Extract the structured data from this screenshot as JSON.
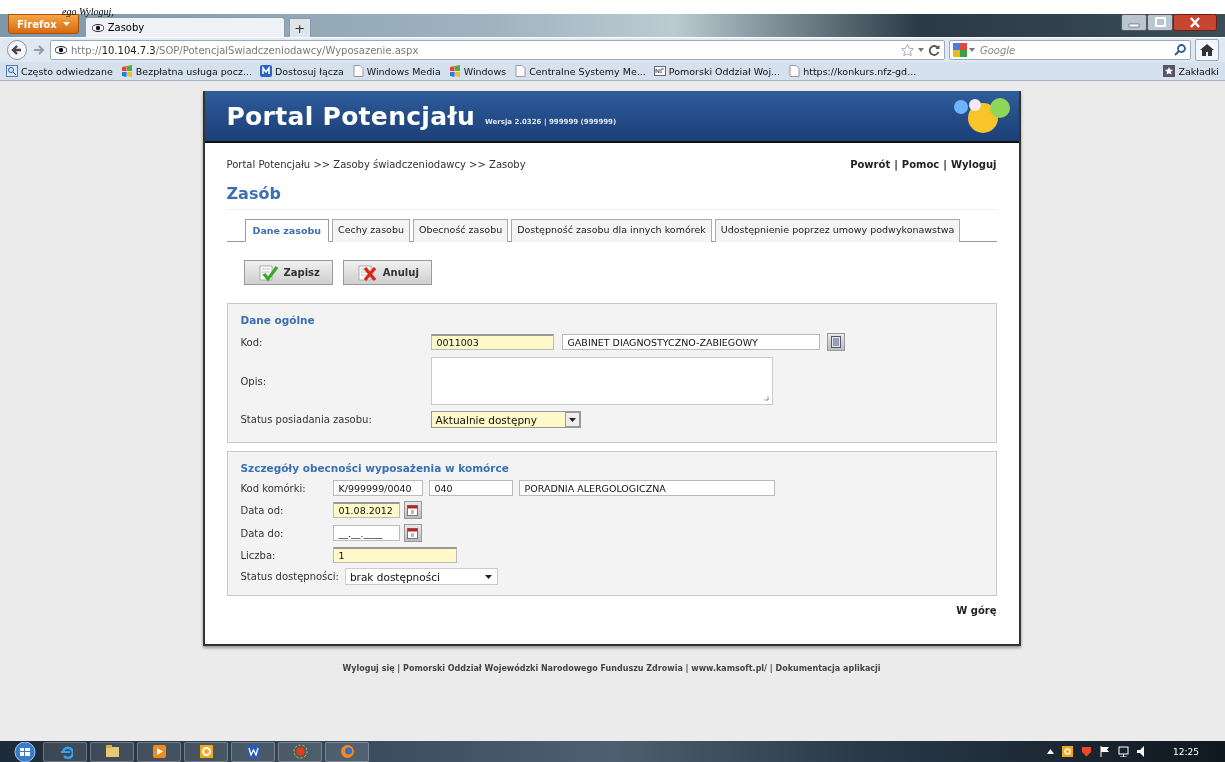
{
  "cut_text": "ego Wyloguj,",
  "browser": {
    "menu_button": "Firefox",
    "tabs": [
      {
        "title": "Zasoby",
        "selected": true
      }
    ],
    "new_tab": "+",
    "address": {
      "scheme": "http://",
      "host": "10.104.7.3",
      "path": "/SOP/PotencjalSwiadczeniodawcy/Wyposazenie.aspx"
    },
    "search": {
      "placeholder": "Google"
    },
    "bookmarks": [
      {
        "label": "Często odwiedzane",
        "kind": "search"
      },
      {
        "label": "Bezpłatna usługa pocz...",
        "kind": "windows"
      },
      {
        "label": "Dostosuj łącza",
        "kind": "m"
      },
      {
        "label": "Windows Media",
        "kind": "page"
      },
      {
        "label": "Windows",
        "kind": "windows"
      },
      {
        "label": "Centralne Systemy Me...",
        "kind": "page"
      },
      {
        "label": "Pomorski Oddział Woj...",
        "kind": "nfz"
      },
      {
        "label": "https://konkurs.nfz-gd...",
        "kind": "page"
      }
    ],
    "bookmarks_menu": "Zakładki"
  },
  "portal": {
    "title": "Portal Potencjału",
    "version": "Wersja 2.0326 | 999999 (999999)",
    "breadcrumb": "Portal Potencjału >> Zasoby świadczeniodawcy >> Zasoby",
    "links": [
      "Powrót",
      "Pomoc",
      "Wyloguj"
    ],
    "link_separator": "|",
    "heading": "Zasób",
    "tabs": [
      {
        "label": "Dane zasobu",
        "selected": true
      },
      {
        "label": "Cechy zasobu",
        "selected": false
      },
      {
        "label": "Obecność zasobu",
        "selected": false
      },
      {
        "label": "Dostępność zasobu dla innych komórek",
        "selected": false
      },
      {
        "label": "Udostępnienie poprzez umowy podwykonawstwa",
        "selected": false
      }
    ],
    "buttons": [
      {
        "label": "Zapisz",
        "kind": "save"
      },
      {
        "label": "Anuluj",
        "kind": "cancel"
      }
    ],
    "general": {
      "title": "Dane ogólne",
      "code_label": "Kod:",
      "code": {
        "value": "0011003",
        "highlighted": true
      },
      "code_name": "GABINET DIAGNOSTYCZNO-ZABIEGOWY",
      "description_label": "Opis:",
      "status_label": "Status posiadania zasobu:",
      "status": {
        "value": "Aktualnie dostępny",
        "highlighted": true
      }
    },
    "details": {
      "title": "Szczegóły obecności wyposażenia w komórce",
      "rows": [
        {
          "kind": "cell",
          "label": "Kod komórki:",
          "values": [
            "K/999999/0040",
            "040",
            "PORADNIA ALERGOLOGICZNA"
          ]
        },
        {
          "kind": "date",
          "label": "Data od:",
          "value": "01.08.2012",
          "highlighted": true
        },
        {
          "kind": "date",
          "label": "Data do:",
          "value": "__.__.____",
          "highlighted": false
        },
        {
          "kind": "number",
          "label": "Liczba:",
          "value": "1",
          "highlighted": true
        },
        {
          "kind": "select",
          "label": "Status dostępności:",
          "value": "brak dostępności"
        }
      ]
    },
    "top_link": "W górę",
    "footer": "Wyloguj się | Pomorski Oddział Wojewódzki Narodowego Funduszu Zdrowia | www.kamsoft.pl/ | Dokumentacja aplikacji"
  },
  "taskbar": {
    "clock": "12:25"
  }
}
